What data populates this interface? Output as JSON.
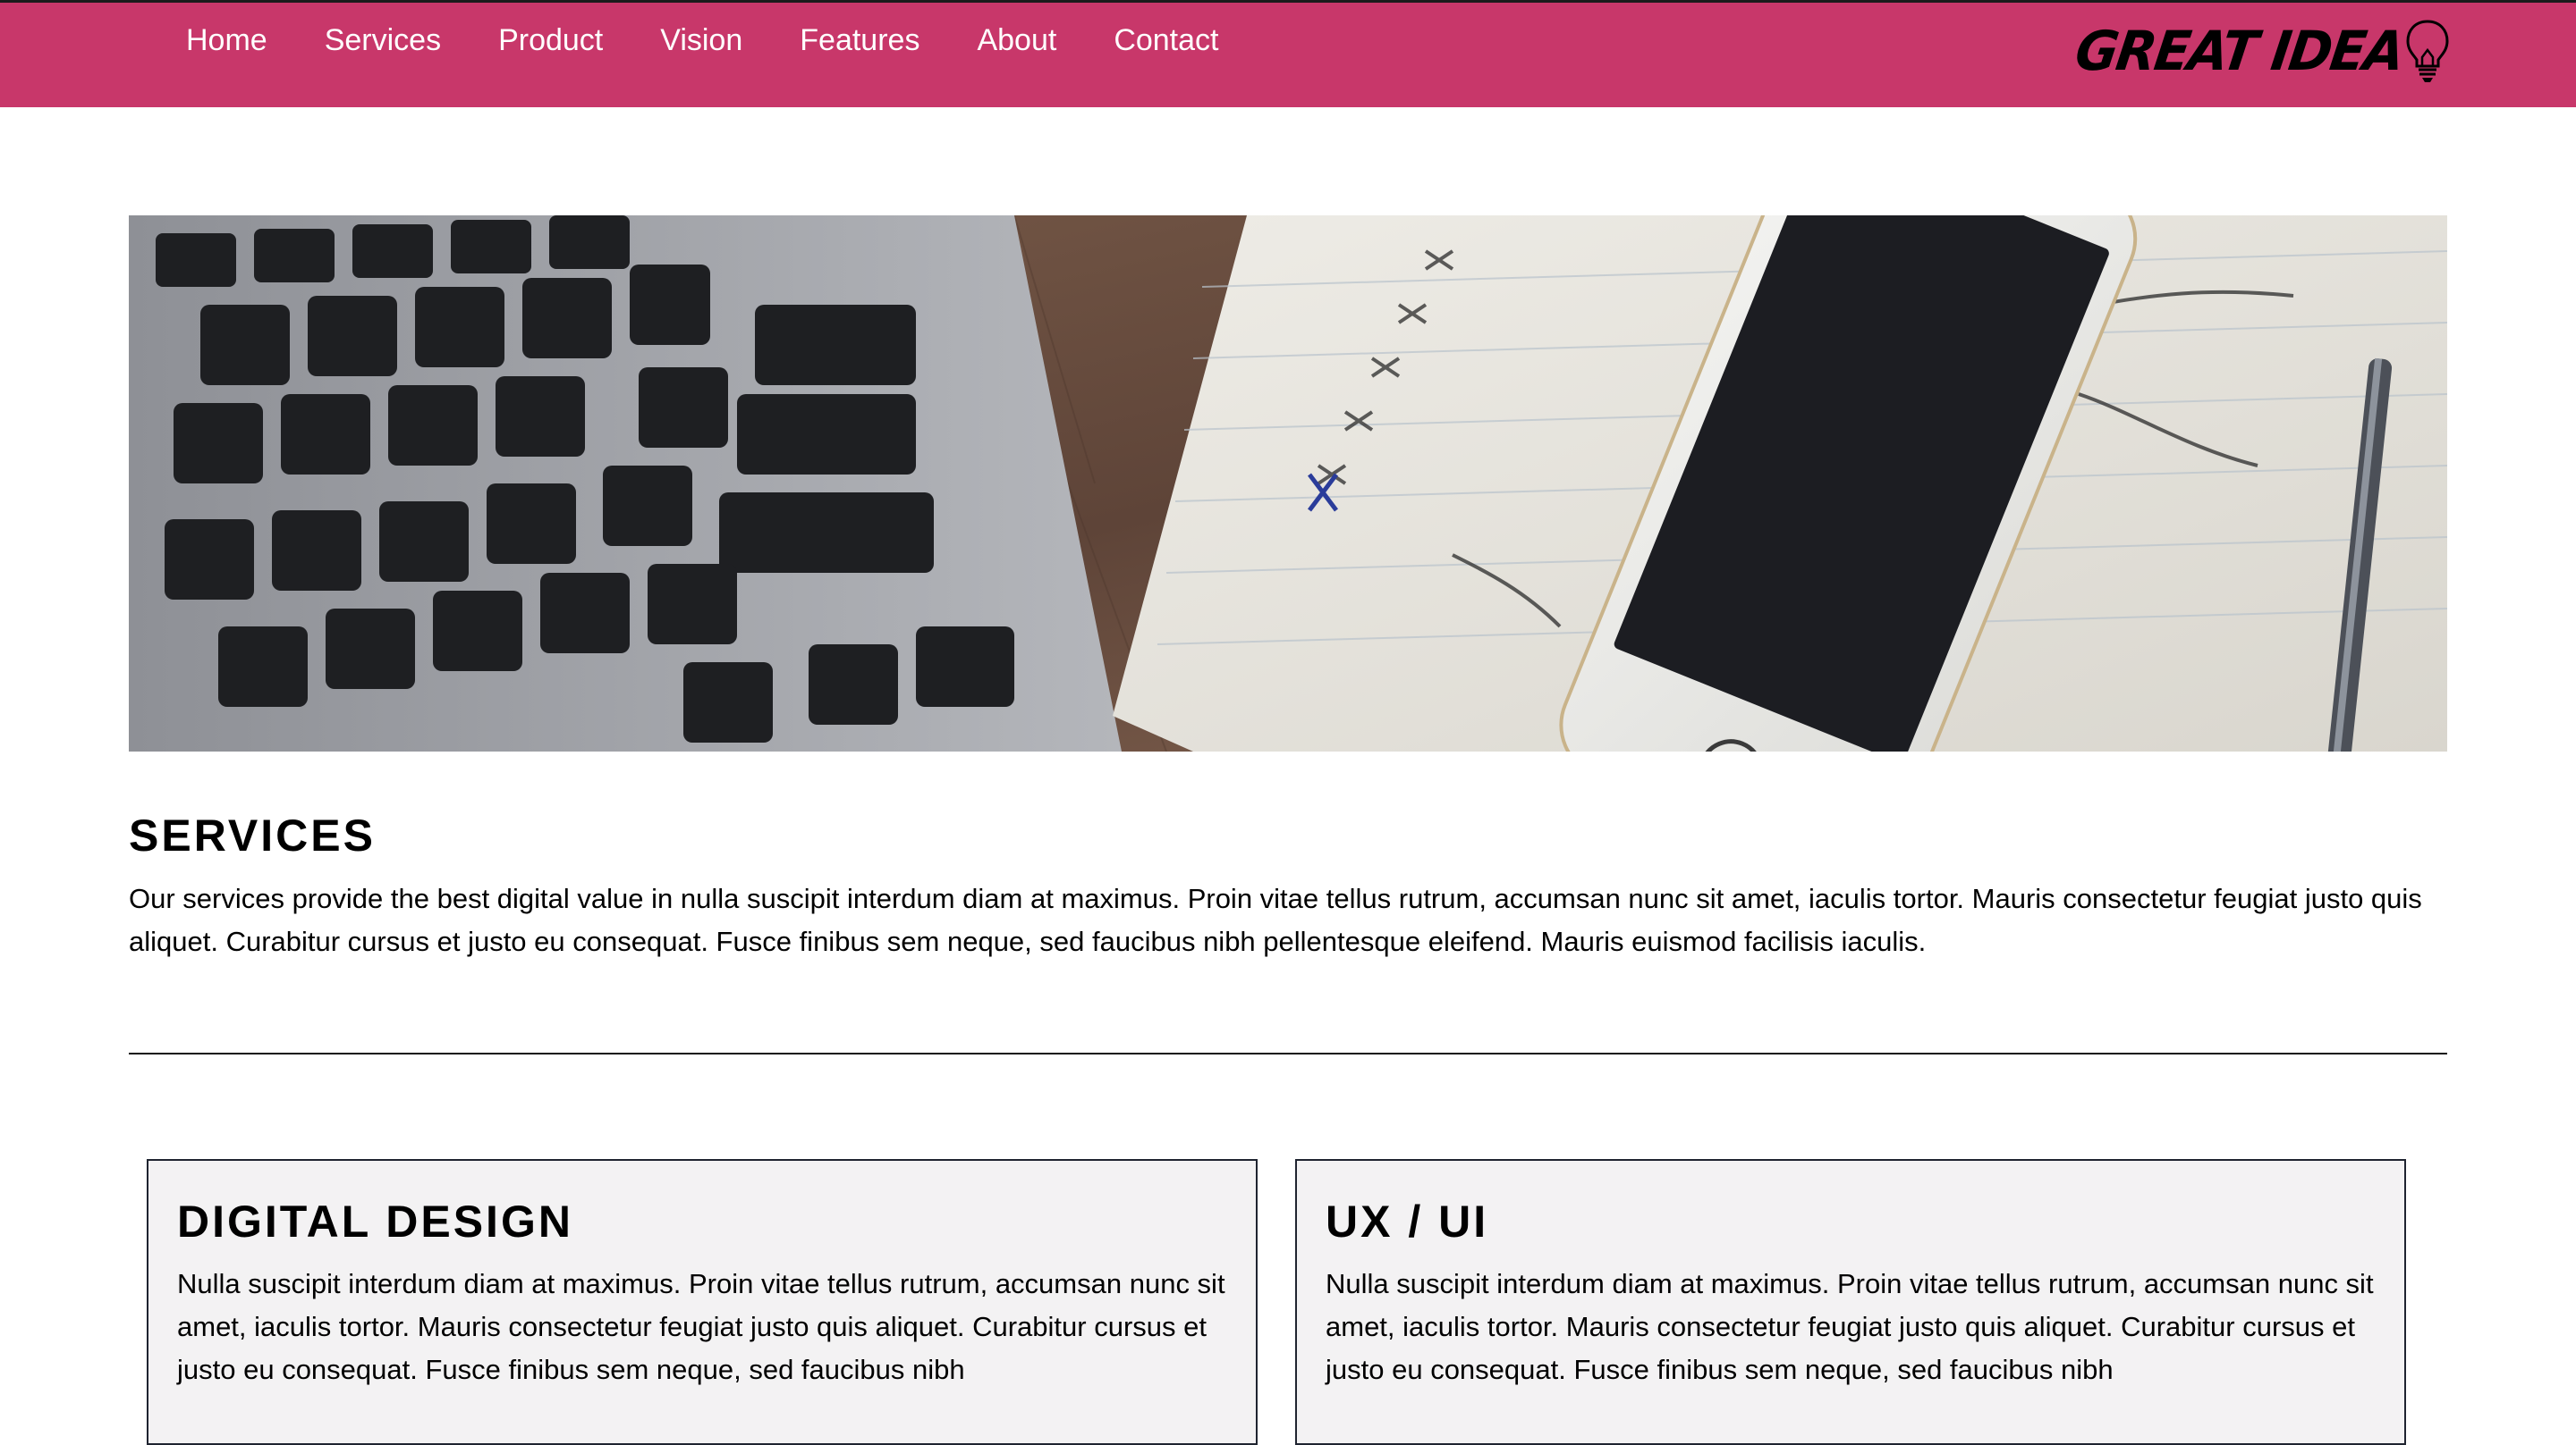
{
  "brand": {
    "name": "GREAT IDEA",
    "accent_color": "#c8376a",
    "icon": "lightbulb-icon"
  },
  "nav": {
    "items": [
      {
        "label": "Home"
      },
      {
        "label": "Services"
      },
      {
        "label": "Product"
      },
      {
        "label": "Vision"
      },
      {
        "label": "Features"
      },
      {
        "label": "About"
      },
      {
        "label": "Contact"
      }
    ]
  },
  "hero": {
    "image": "laptop-notebook-phone-desk-photo"
  },
  "services": {
    "title": "SERVICES",
    "body": "Our services provide the best digital value in nulla suscipit interdum diam at maximus. Proin vitae tellus rutrum, accumsan nunc sit amet, iaculis tortor. Mauris consectetur feugiat justo quis aliquet. Curabitur cursus et justo eu consequat. Fusce finibus sem neque, sed faucibus nibh pellentesque eleifend. Mauris euismod facilisis iaculis."
  },
  "cards": [
    {
      "title": "DIGITAL DESIGN",
      "body": "Nulla suscipit interdum diam at maximus. Proin vitae tellus rutrum, accumsan nunc sit amet, iaculis tortor. Mauris consectetur feugiat justo quis aliquet. Curabitur cursus et justo eu consequat. Fusce finibus sem neque, sed faucibus nibh"
    },
    {
      "title": "UX / UI",
      "body": "Nulla suscipit interdum diam at maximus. Proin vitae tellus rutrum, accumsan nunc sit amet, iaculis tortor. Mauris consectetur feugiat justo quis aliquet. Curabitur cursus et justo eu consequat. Fusce finibus sem neque, sed faucibus nibh"
    }
  ]
}
